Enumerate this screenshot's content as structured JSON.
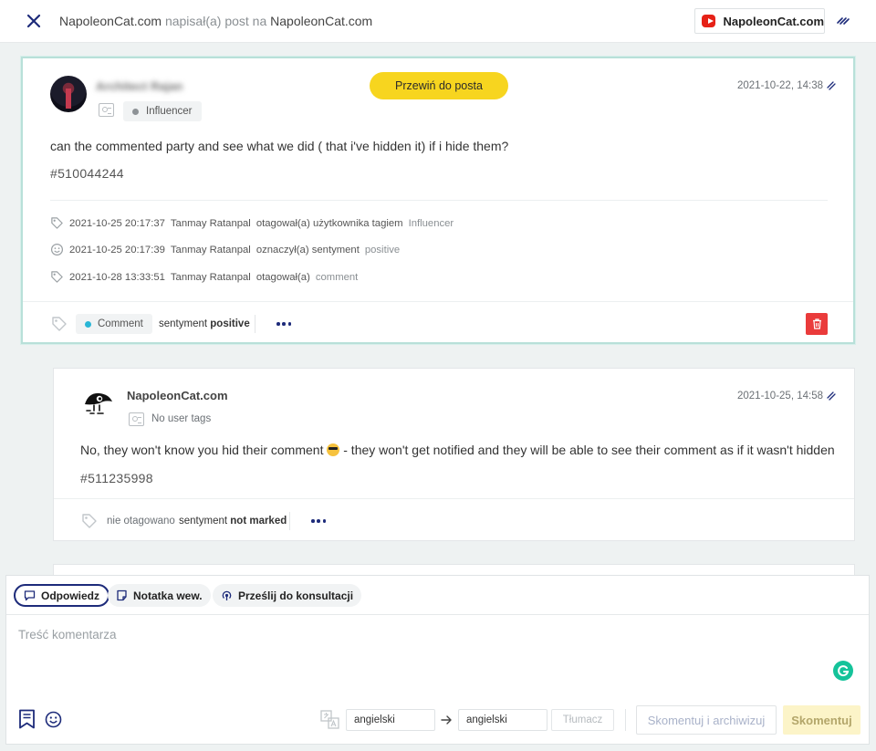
{
  "header": {
    "author": "NapoleonCat.com",
    "action": "napisał(a) post na",
    "target": "NapoleonCat.com",
    "channel_name": "NapoleonCat.com"
  },
  "main_post": {
    "author": "Architect Rajan",
    "user_tag": "Influencer",
    "scroll_button": "Przewiń do posta",
    "timestamp": "2021-10-22, 14:38",
    "text": "can the commented party and see what we did ( that i've hidden it) if i hide them?",
    "id": "#510044244",
    "history": [
      {
        "time": "2021-10-25 20:17:37",
        "actor": "Tanmay Ratanpal",
        "action": "otagował(a) użytkownika tagiem",
        "value": "Influencer"
      },
      {
        "time": "2021-10-25 20:17:39",
        "actor": "Tanmay Ratanpal",
        "action": "oznaczył(a) sentyment",
        "value": "positive"
      },
      {
        "time": "2021-10-28 13:33:51",
        "actor": "Tanmay Ratanpal",
        "action": "otagował(a)",
        "value": "comment"
      }
    ],
    "tag": "Comment",
    "tag_color": "#29b6d6",
    "sentiment_label": "sentyment",
    "sentiment_value": "positive"
  },
  "reply": {
    "author": "NapoleonCat.com",
    "user_tags": "No user tags",
    "timestamp": "2021-10-25, 14:58",
    "text_before": "No, they won't know you hid their comment",
    "text_after": "- they won't get notified and they will be able to see their comment as if it wasn't hidden",
    "id": "#511235998",
    "tag_status": "nie otagowano",
    "sentiment_label": "sentyment",
    "sentiment_value": "not marked"
  },
  "composer": {
    "tabs": [
      {
        "label": "Odpowiedz",
        "active": true
      },
      {
        "label": "Notatka wew.",
        "active": false
      },
      {
        "label": "Prześlij do konsultacji",
        "active": false
      }
    ],
    "placeholder": "Treść komentarza",
    "source_lang": "angielski",
    "target_lang": "angielski",
    "translate_label": "Tłumacz",
    "archive_label": "Skomentuj i archiwizuj",
    "submit_label": "Skomentuj"
  },
  "colors": {
    "accent": "#1d2b7a",
    "yellow": "#f7d51f",
    "delete": "#ea3b3b",
    "youtube": "#e62117",
    "grammarly": "#15c39a"
  },
  "icons": [
    "close-icon",
    "youtube-icon",
    "link-icon",
    "tag-icon",
    "smiley-icon",
    "trash-icon",
    "bookmark-icon",
    "translate-icon",
    "grammarly-icon"
  ]
}
